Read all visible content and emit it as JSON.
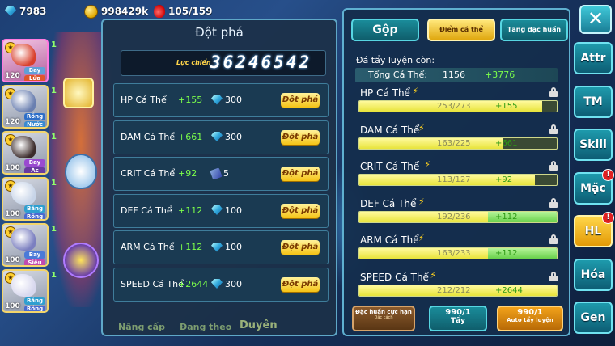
{
  "resources": {
    "gems": "7983",
    "gold": "998429k",
    "energy": "105/159"
  },
  "team": [
    {
      "level": "120",
      "tags": [
        "Bay",
        "Lửa"
      ],
      "count": "1"
    },
    {
      "level": "120",
      "tags": [
        "Rồng",
        "Nước"
      ],
      "count": "1"
    },
    {
      "level": "100",
      "tags": [
        "Bay",
        "Ác"
      ],
      "count": "1"
    },
    {
      "level": "100",
      "tags": [
        "Băng",
        "Rồng"
      ],
      "count": "1"
    },
    {
      "level": "100",
      "tags": [
        "Bay",
        "Siêu"
      ],
      "count": "1"
    },
    {
      "level": "100",
      "tags": [
        "Băng",
        "Rồng"
      ],
      "count": "1"
    }
  ],
  "breakthrough": {
    "title": "Đột phá",
    "power_label": "Lực chiến",
    "power_value": "36246542",
    "rows": [
      {
        "name": "HP Cá Thể",
        "bonus": "+155",
        "cost": "300",
        "cost_icon": "gem-icon",
        "button": "Đột phá"
      },
      {
        "name": "DAM Cá Thể",
        "bonus": "+661",
        "cost": "300",
        "cost_icon": "gem-icon",
        "button": "Đột phá"
      },
      {
        "name": "CRIT Cá Thể",
        "bonus": "+92",
        "cost": "5",
        "cost_icon": "scroll-icon",
        "button": "Đột phá"
      },
      {
        "name": "DEF Cá Thể",
        "bonus": "+112",
        "cost": "100",
        "cost_icon": "gem-icon",
        "button": "Đột phá"
      },
      {
        "name": "ARM Cá Thể",
        "bonus": "+112",
        "cost": "100",
        "cost_icon": "gem-icon",
        "button": "Đột phá"
      },
      {
        "name": "SPEED Cá Thể",
        "bonus": "+2644",
        "cost": "300",
        "cost_icon": "gem-icon",
        "button": "Đột phá"
      }
    ]
  },
  "individual": {
    "tabs": [
      "Gộp",
      "Điểm cá thể",
      "Tăng đặc huấn"
    ],
    "subheading": "Đá tẩy luyện còn:",
    "total": {
      "label": "Tổng Cá Thể:",
      "value": "1156",
      "bonus": "+3776"
    },
    "stats": [
      {
        "name": "HP Cá Thể",
        "current": "253/273",
        "add": "+155",
        "fill": 0.927,
        "ext": 0.0,
        "locked": false
      },
      {
        "name": "DAM Cá Thể",
        "current": "163/225",
        "add": "+661",
        "fill": 0.724,
        "ext": 0.0,
        "locked": false
      },
      {
        "name": "CRIT Cá Thể",
        "current": "113/127",
        "add": "+92",
        "fill": 0.89,
        "ext": 0.0,
        "locked": false
      },
      {
        "name": "DEF Cá Thể",
        "current": "192/236",
        "add": "+112",
        "fill": 0.65,
        "ext": 0.35,
        "locked": false
      },
      {
        "name": "ARM Cá Thể",
        "current": "163/233",
        "add": "+112",
        "fill": 0.65,
        "ext": 0.35,
        "locked": false
      },
      {
        "name": "SPEED Cá Thể",
        "current": "212/212",
        "add": "+2644",
        "fill": 1.0,
        "ext": 0.0,
        "locked": false
      }
    ],
    "buttons": [
      {
        "title": "Đặc huấn cực hạn",
        "sub": "Dắc cách",
        "count": ""
      },
      {
        "title": "Tẩy",
        "sub": "",
        "count": "990/1"
      },
      {
        "title": "Auto tẩy luyện",
        "sub": "",
        "count": "990/1"
      }
    ]
  },
  "side_nav": [
    {
      "label": "Attr",
      "alert": false
    },
    {
      "label": "TM",
      "alert": false
    },
    {
      "label": "Skill",
      "alert": false
    },
    {
      "label": "Mặc",
      "alert": true
    },
    {
      "label": "HL",
      "alert": true,
      "active": true
    },
    {
      "label": "Hóa",
      "alert": false
    },
    {
      "label": "Gen",
      "alert": false
    }
  ],
  "bottom_nav": [
    "Nâng cấp",
    "Đang theo",
    "Duyên"
  ],
  "close_label": "✕"
}
